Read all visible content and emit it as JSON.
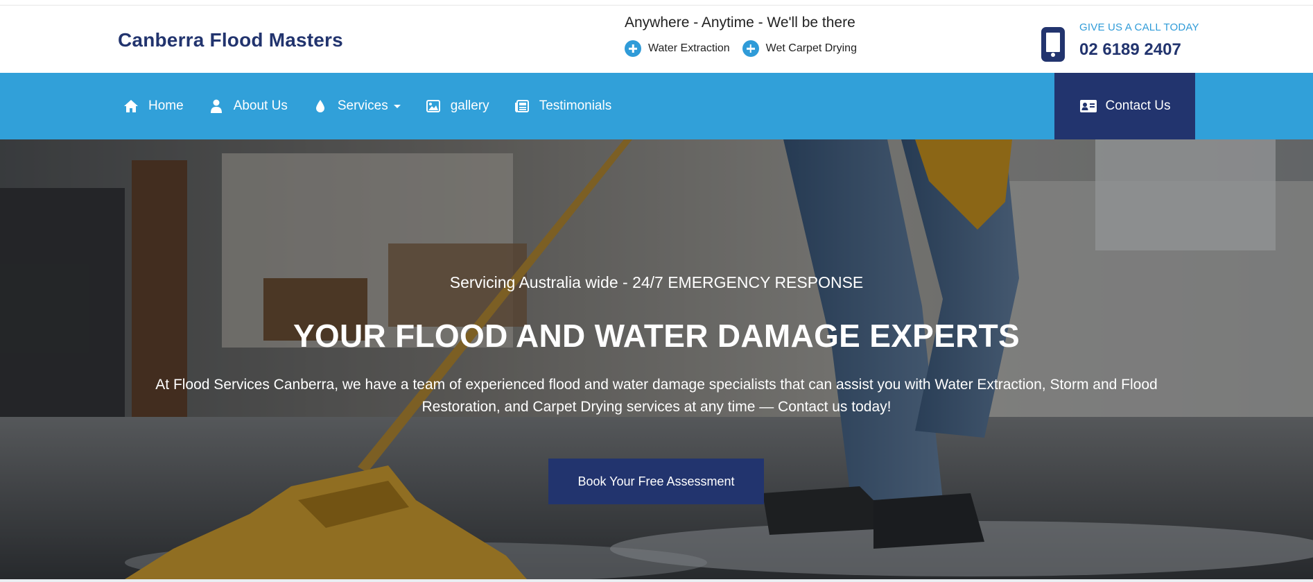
{
  "header": {
    "brand": "Canberra Flood Masters",
    "tagline": "Anywhere - Anytime - We'll be there",
    "service_tags": [
      "Water Extraction",
      "Wet Carpet Drying"
    ],
    "call_label": "GIVE US A CALL TODAY",
    "phone": "02 6189 2407"
  },
  "nav": {
    "items": [
      {
        "label": "Home",
        "icon": "home-icon"
      },
      {
        "label": "About Us",
        "icon": "user-icon"
      },
      {
        "label": "Services",
        "icon": "water-drop-icon"
      },
      {
        "label": "gallery",
        "icon": "image-icon"
      },
      {
        "label": "Testimonials",
        "icon": "newspaper-icon"
      }
    ],
    "contact_label": "Contact Us"
  },
  "hero": {
    "subheading": "Servicing Australia wide - 24/7 EMERGENCY RESPONSE",
    "title": "YOUR FLOOD AND WATER DAMAGE EXPERTS",
    "description": "At Flood Services Canberra, we have a team of experienced flood and water damage specialists that can assist you with Water Extraction, Storm and Flood Restoration, and Carpet Drying services at any time — Contact us today!",
    "cta_label": "Book Your Free Assessment"
  },
  "colors": {
    "primary_navy": "#22346e",
    "accent_blue": "#31a0d9",
    "white": "#ffffff"
  }
}
